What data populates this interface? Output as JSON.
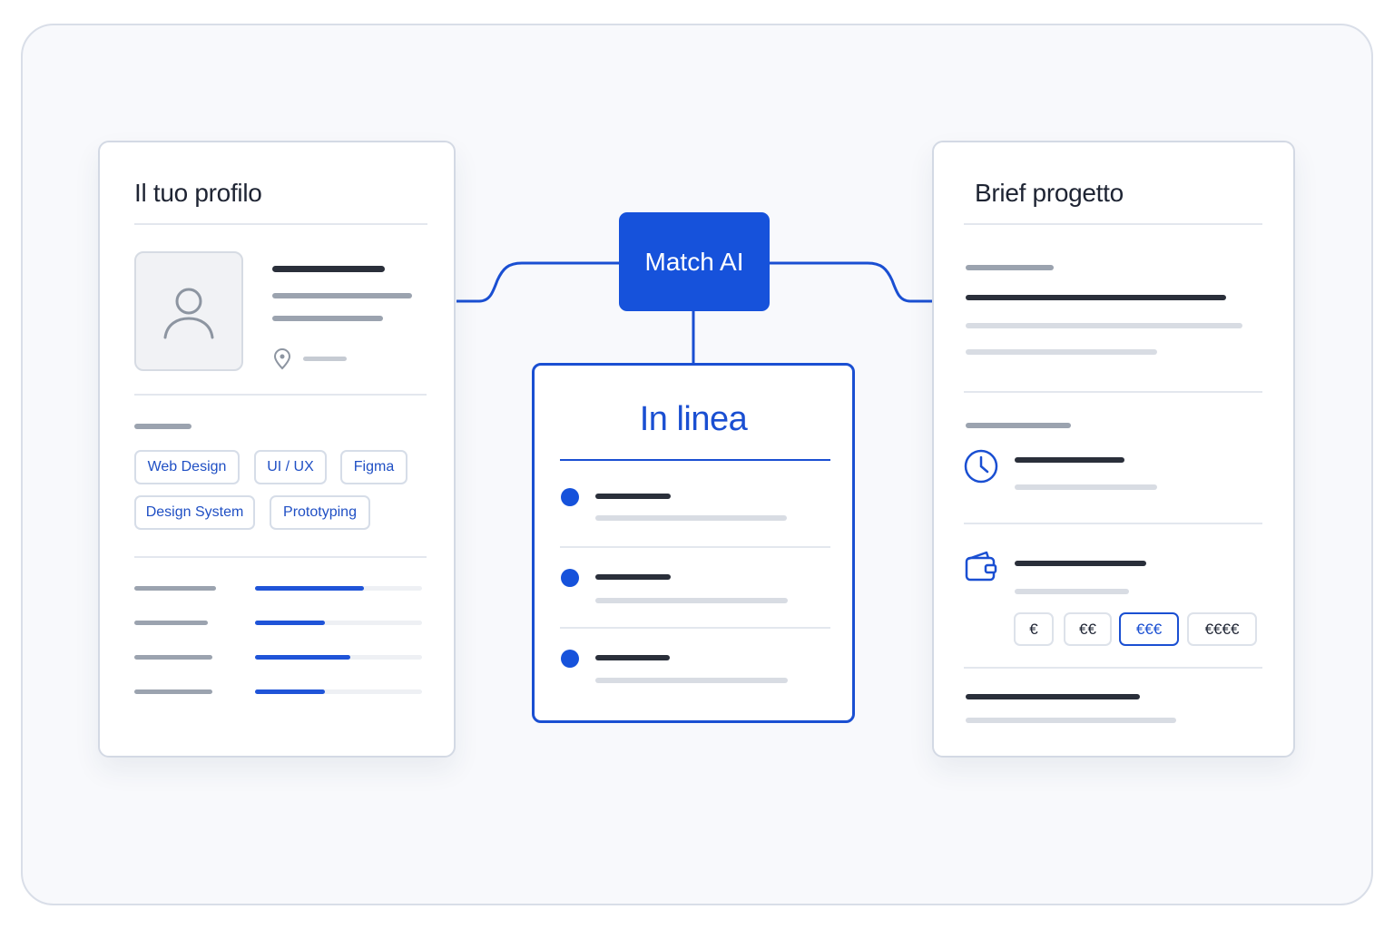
{
  "profile_card": {
    "title": "Il tuo profilo",
    "skills": [
      "Web Design",
      "UI / UX",
      "Figma",
      "Design System",
      "Prototyping"
    ],
    "skill_levels": [
      0.65,
      0.42,
      0.57,
      0.42
    ]
  },
  "match": {
    "label": "Match AI"
  },
  "results_card": {
    "title": "In linea"
  },
  "brief_card": {
    "title": "Brief progetto",
    "budget_options": [
      "€",
      "€€",
      "€€€",
      "€€€€"
    ],
    "selected_budget": "€€€"
  },
  "colors": {
    "accent": "#1652db",
    "text": "#1e2433",
    "border": "#d3d9e4"
  },
  "icons": [
    "user-icon",
    "map-pin-icon",
    "clock-icon",
    "wallet-icon"
  ]
}
